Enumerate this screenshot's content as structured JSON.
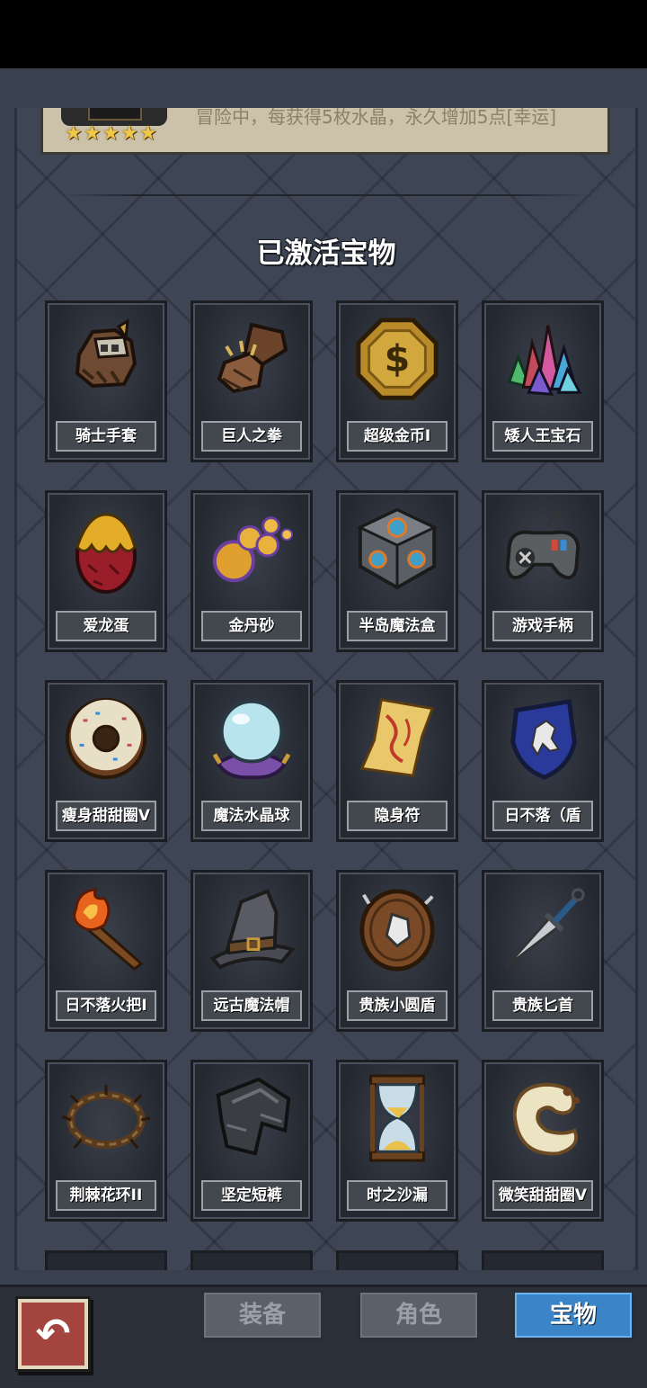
{
  "header": {
    "description": "冒险中，每获得5枚水晶，永久增加5点[幸运]",
    "stars": [
      "★",
      "★",
      "★",
      "★",
      "★"
    ]
  },
  "section_title": "已激活宝物",
  "items": [
    {
      "name": "骑士手套",
      "icon": "gauntlet-icon"
    },
    {
      "name": "巨人之拳",
      "icon": "spiked-fist-icon"
    },
    {
      "name": "超级金币I",
      "icon": "gold-coin-icon"
    },
    {
      "name": "矮人王宝石",
      "icon": "gem-cluster-icon"
    },
    {
      "name": "爱龙蛋",
      "icon": "dragon-egg-icon"
    },
    {
      "name": "金丹砂",
      "icon": "golden-orbs-icon"
    },
    {
      "name": "半岛魔法盒",
      "icon": "magic-cube-icon"
    },
    {
      "name": "游戏手柄",
      "icon": "gamepad-icon"
    },
    {
      "name": "瘦身甜甜圈V",
      "icon": "donut-icon"
    },
    {
      "name": "魔法水晶球",
      "icon": "crystal-ball-icon"
    },
    {
      "name": "隐身符",
      "icon": "talisman-icon"
    },
    {
      "name": "日不落（盾",
      "icon": "lion-shield-icon"
    },
    {
      "name": "日不落火把I",
      "icon": "torch-icon"
    },
    {
      "name": "远古魔法帽",
      "icon": "wizard-hat-icon"
    },
    {
      "name": "贵族小圆盾",
      "icon": "round-shield-icon"
    },
    {
      "name": "贵族匕首",
      "icon": "dagger-icon"
    },
    {
      "name": "荆棘花环II",
      "icon": "thorn-wreath-icon"
    },
    {
      "name": "坚定短裤",
      "icon": "armored-shorts-icon"
    },
    {
      "name": "时之沙漏",
      "icon": "hourglass-icon"
    },
    {
      "name": "微笑甜甜圈V",
      "icon": "smile-donut-icon"
    }
  ],
  "tabs": [
    {
      "label": "装备",
      "active": false
    },
    {
      "label": "角色",
      "active": false
    },
    {
      "label": "宝物",
      "active": true
    }
  ],
  "back_icon": "back-arrow-icon"
}
